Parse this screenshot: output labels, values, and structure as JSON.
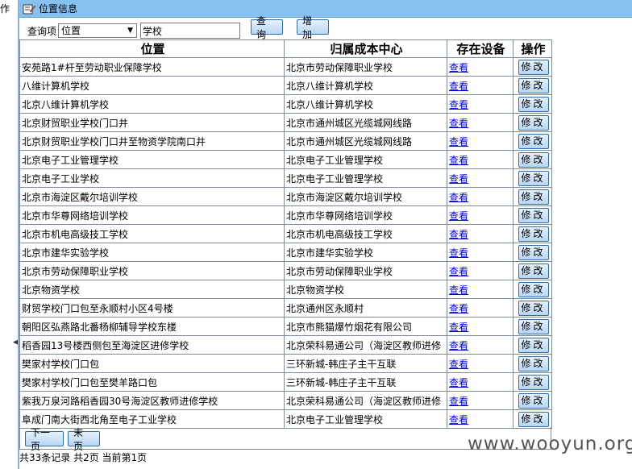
{
  "gutter": {
    "label": "作"
  },
  "window": {
    "title": "位置信息"
  },
  "search": {
    "label": "查询项",
    "field_selected": "位置",
    "keyword_value": "学校",
    "query_button": "查询",
    "add_button": "增加"
  },
  "table": {
    "headers": [
      "位置",
      "归属成本中心",
      "存在设备",
      "操作"
    ],
    "rows": [
      {
        "location": "安苑路1#杆至劳动职业保障学校",
        "cost_center": "北京市劳动保障职业学校",
        "device": "查看",
        "action": "修改"
      },
      {
        "location": "八维计算机学校",
        "cost_center": "北京八维计算机学校",
        "device": "查看",
        "action": "修改"
      },
      {
        "location": "北京八维计算机学校",
        "cost_center": "北京八维计算机学校",
        "device": "查看",
        "action": "修改"
      },
      {
        "location": "北京财贸职业学校门口井",
        "cost_center": "北京市通州城区光缆城网线路",
        "device": "查看",
        "action": "修改"
      },
      {
        "location": "北京财贸职业学校门口井至物资学院南口井",
        "cost_center": "北京市通州城区光缆城网线路",
        "device": "查看",
        "action": "修改"
      },
      {
        "location": "北京电子工业管理学校",
        "cost_center": "北京电子工业管理学校",
        "device": "查看",
        "action": "修改"
      },
      {
        "location": "北京电子工业学校",
        "cost_center": "北京电子工业管理学校",
        "device": "查看",
        "action": "修改"
      },
      {
        "location": "北京市海淀区戴尔培训学校",
        "cost_center": "北京市海淀区戴尔培训学校",
        "device": "查看",
        "action": "修改"
      },
      {
        "location": "北京市华尊网络培训学校",
        "cost_center": "北京市华尊网络培训学校",
        "device": "查看",
        "action": "修改"
      },
      {
        "location": "北京市机电高级技工学校",
        "cost_center": "北京市机电高级技工学校",
        "device": "查看",
        "action": "修改"
      },
      {
        "location": "北京市建华实验学校",
        "cost_center": "北京市建华实验学校",
        "device": "查看",
        "action": "修改"
      },
      {
        "location": "北京市劳动保障职业学校",
        "cost_center": "北京市劳动保障职业学校",
        "device": "查看",
        "action": "修改"
      },
      {
        "location": "北京物资学校",
        "cost_center": "北京物资学校",
        "device": "查看",
        "action": "修改"
      },
      {
        "location": "财贸学校门口包至永顺村小区4号楼",
        "cost_center": "北京通州区永顺村",
        "device": "查看",
        "action": "修改"
      },
      {
        "location": "朝阳区弘燕路北番杨柳辅导学校东楼",
        "cost_center": "北京市熊猫爆竹烟花有限公司",
        "device": "查看",
        "action": "修改"
      },
      {
        "location": "稻香园13号楼西侧包至海淀区进修学校",
        "cost_center": "北京荣科易通公司（海淀区教师进修",
        "device": "查看",
        "action": "修改"
      },
      {
        "location": "樊家村学校门口包",
        "cost_center": "三环新城-韩庄子主干互联",
        "device": "查看",
        "action": "修改"
      },
      {
        "location": "樊家村学校门口包至樊羊路口包",
        "cost_center": "三环新城-韩庄子主干互联",
        "device": "查看",
        "action": "修改"
      },
      {
        "location": "紫我万泉河路稻香园30号海淀区教师进修学校",
        "cost_center": "北京荣科易通公司（海淀区教师进修",
        "device": "查看",
        "action": "修改"
      },
      {
        "location": "阜成门南大街西北角至电子工业学校",
        "cost_center": "北京电子工业管理学校",
        "device": "查看",
        "action": "修改"
      }
    ]
  },
  "pager": {
    "next_label": "下一页",
    "last_label": "末页",
    "summary": "共33条记录 共2页 当前第1页"
  },
  "watermark": "www.wooyun.org",
  "colors": {
    "titlebar": "#87c1f0",
    "button_border": "#2f6db0",
    "link": "#0000ee"
  }
}
